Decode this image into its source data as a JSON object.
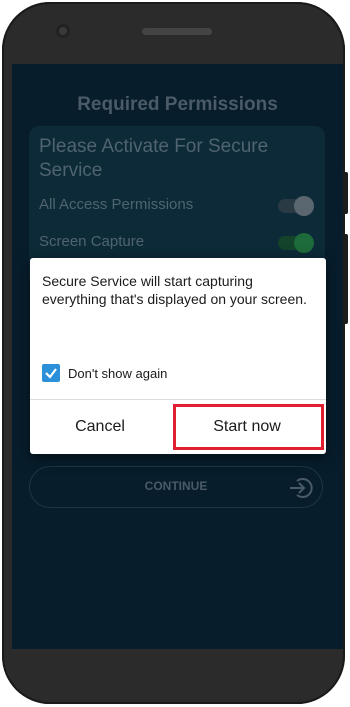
{
  "screen": {
    "title": "Required Permissions",
    "permissions_heading": "Please Activate For Secure Service",
    "permissions": [
      {
        "label": "All Access Permissions",
        "enabled": false
      },
      {
        "label": "Screen Capture",
        "enabled": true
      }
    ],
    "continue_label": "CONTINUE"
  },
  "dialog": {
    "message": "Secure Service will start capturing everything that's displayed on your screen.",
    "checkbox_label": "Don't show again",
    "checkbox_checked": true,
    "cancel_label": "Cancel",
    "start_label": "Start now"
  },
  "colors": {
    "background": "#071d2c",
    "checkbox": "#2b8fd9",
    "highlight": "#e02030"
  }
}
